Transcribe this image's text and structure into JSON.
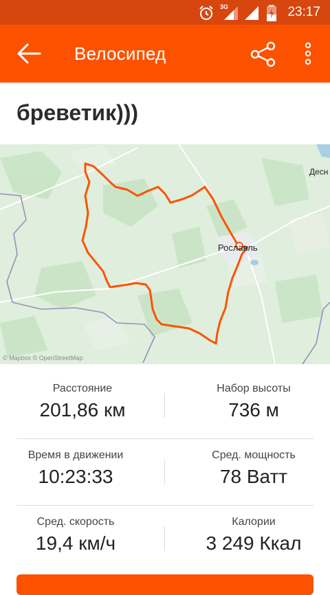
{
  "status_bar": {
    "time": "23:17",
    "network": "3G"
  },
  "app_bar": {
    "title": "Велосипед"
  },
  "activity": {
    "name": "бреветик)))"
  },
  "map": {
    "city_label": "Рославль",
    "edge_label": "Десн",
    "attribution": "© Mapbox © OpenStreetMap"
  },
  "stats": [
    {
      "label": "Расстояние",
      "value": "201,86 км"
    },
    {
      "label": "Набор высоты",
      "value": "736 м"
    },
    {
      "label": "Время в движении",
      "value": "10:23:33"
    },
    {
      "label": "Сред. мощность",
      "value": "78 Ватт"
    },
    {
      "label": "Сред. скорость",
      "value": "19,4 км/ч"
    },
    {
      "label": "Калории",
      "value": "3 249 Ккал"
    }
  ],
  "colors": {
    "accent": "#fc5200",
    "status_bar": "#d7460f",
    "route": "#fc5200"
  }
}
